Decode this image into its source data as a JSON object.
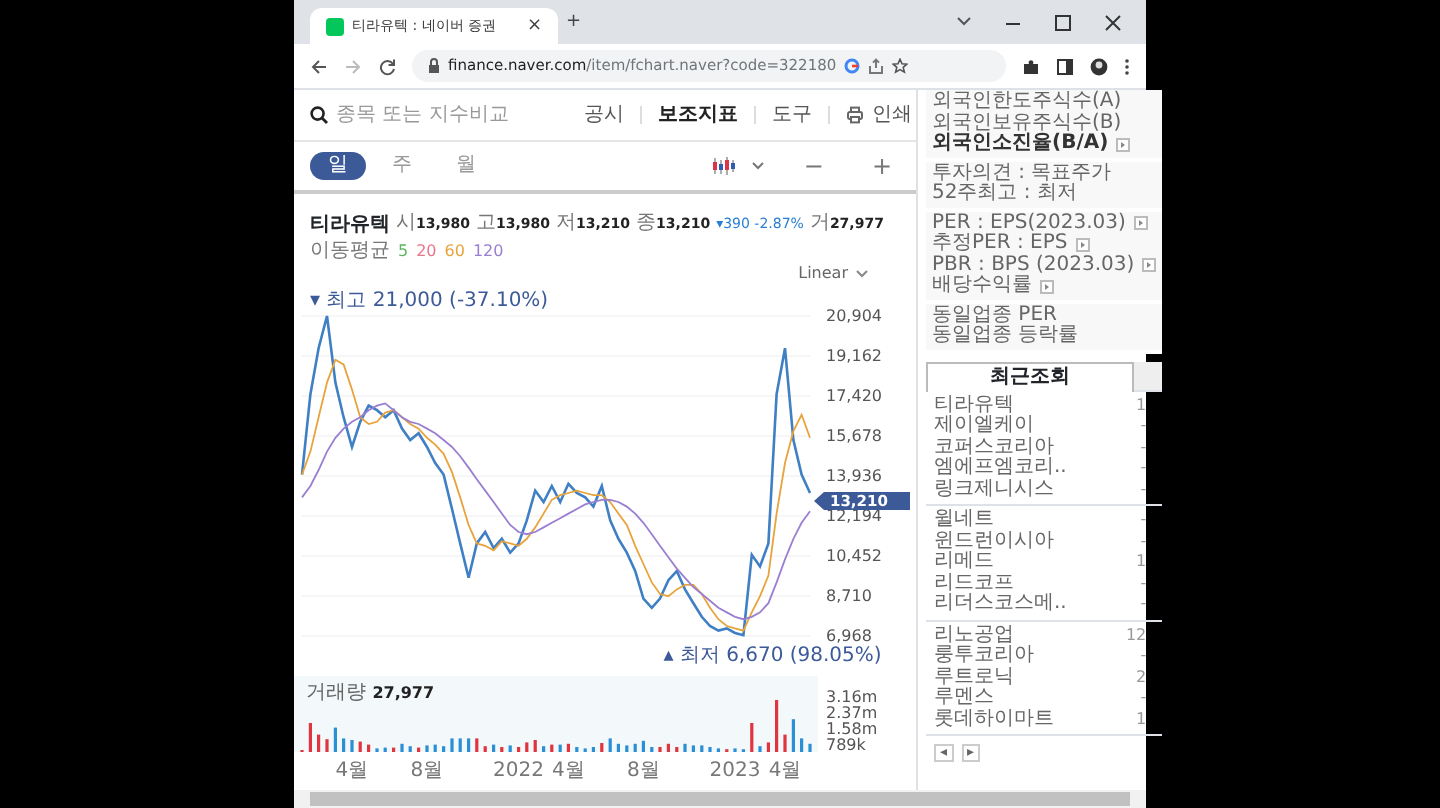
{
  "browser": {
    "tab": {
      "title": "티라유텍 : 네이버 증권",
      "selected": true
    },
    "tab_close": "×",
    "new_tab": "+",
    "url_host": "finance.naver.com",
    "url_path": "/item/fchart.naver?code=322180"
  },
  "search": {
    "placeholder": "종목 또는 지수비교"
  },
  "tools": [
    {
      "label": "공시",
      "kind": "link"
    },
    {
      "label": "보조지표",
      "kind": "bold"
    },
    {
      "label": "도구",
      "kind": "link"
    },
    {
      "label": "인쇄",
      "kind": "print"
    }
  ],
  "periods": [
    {
      "label": "일",
      "selected": true
    },
    {
      "label": "주",
      "selected": false
    },
    {
      "label": "월",
      "selected": false
    }
  ],
  "zoom": [
    "−",
    "+"
  ],
  "quote": {
    "items": [
      {
        "label": "시",
        "value": "13,980"
      },
      {
        "label": "고",
        "value": "13,980"
      },
      {
        "label": "저",
        "value": "13,210"
      },
      {
        "label": "종",
        "value": "13,210"
      }
    ],
    "change": "▾390 -2.87%",
    "volume_label": "거",
    "volume": "27,977"
  },
  "moving_average": {
    "label": "이동평균",
    "periods": [
      {
        "label": "5",
        "color": "#5cb85c"
      },
      {
        "label": "20",
        "color": "#e8768a"
      }
    ]
  },
  "scale": "Linear",
  "chart": {
    "high_label": "▾ 최고 21,000 (-37.10%)",
    "low_label": "▴ 최저 6,670 (98.05%)",
    "current_price": "13,210",
    "chart_data": {
      "type": "line",
      "grid": true,
      "ylim": [
        6968,
        20904
      ],
      "categories": [
        null,
        null,
        null,
        null,
        null,
        null,
        "4월",
        null,
        null,
        null,
        null,
        null,
        null,
        null,
        null,
        "8월",
        null,
        null,
        null,
        null,
        null,
        null,
        null,
        null,
        null,
        null,
        "2022",
        null,
        null,
        null,
        null,
        null,
        "4월",
        null,
        null,
        null,
        null,
        null,
        null,
        null,
        null,
        "8월",
        null,
        null,
        null,
        null,
        null,
        null,
        null,
        null,
        null,
        null,
        "2023",
        null,
        null,
        null,
        null,
        null,
        "4월",
        null,
        null,
        null
      ],
      "series": [
        {
          "name": "티라유텍",
          "color": "#3f7fc4",
          "values": [
            14000,
            17500,
            19500,
            20900,
            18000,
            16500,
            15200,
            16300,
            17000,
            16800,
            16500,
            16800,
            16000,
            15500,
            15800,
            15200,
            14500,
            14000,
            12500,
            11000,
            9500,
            11000,
            11500,
            10800,
            11200,
            10600,
            11000,
            12000,
            13300,
            12800,
            13500,
            12800,
            13600,
            13200,
            13000,
            12600,
            13500,
            12000,
            11200,
            10600,
            9800,
            8600,
            8200,
            8600,
            9400,
            9800,
            9000,
            8400,
            7800,
            7400,
            7200,
            7300,
            7100,
            7000,
            10500,
            10000,
            11000,
            17500,
            19500,
            15500,
            14000,
            13200
          ]
        },
        {
          "name": "60",
          "color": "#e8a33c",
          "values": [
            14000,
            15000,
            16500,
            18000,
            19000,
            18800,
            17700,
            16500,
            16200,
            16300,
            16700,
            16800,
            16500,
            16200,
            16000,
            15600,
            15300,
            14900,
            14100,
            13000,
            11800,
            11000,
            10900,
            10700,
            11100,
            11000,
            10900,
            11200,
            11700,
            12300,
            12900,
            13100,
            13200,
            13300,
            13200,
            13100,
            13100,
            12800,
            12300,
            11800,
            10900,
            10100,
            9300,
            8800,
            8700,
            9000,
            9200,
            9200,
            8800,
            8200,
            7700,
            7400,
            7300,
            7200,
            8000,
            8700,
            9600,
            12300,
            14500,
            15900,
            16600,
            15600
          ]
        },
        {
          "name": "120",
          "color": "#9a7fd1",
          "values": [
            13000,
            13500,
            14200,
            15000,
            15600,
            16000,
            16300,
            16500,
            16800,
            17000,
            17100,
            16800,
            16500,
            16300,
            16200,
            16000,
            15800,
            15500,
            15200,
            14800,
            14300,
            13800,
            13300,
            12800,
            12300,
            11800,
            11500,
            11400,
            11500,
            11700,
            11900,
            12100,
            12300,
            12500,
            12700,
            12800,
            12900,
            12900,
            12800,
            12600,
            12300,
            11900,
            11400,
            10900,
            10400,
            9900,
            9500,
            9100,
            8800,
            8500,
            8200,
            8000,
            7800,
            7700,
            7800,
            8000,
            8400,
            9300,
            10300,
            11200,
            11900,
            12400
          ]
        }
      ],
      "yticks": [
        {
          "value": 20904,
          "label": "20,904"
        },
        {
          "value": 19162,
          "label": "19,162"
        },
        {
          "value": 17420,
          "label": "17,420"
        },
        {
          "value": 15678,
          "label": "15,678"
        },
        {
          "value": 13936,
          "label": "13,936"
        },
        {
          "value": 12194,
          "label": "12,194"
        },
        {
          "value": 10452,
          "label": "10,452"
        },
        {
          "value": 8710,
          "label": "8,710"
        },
        {
          "value": 6968,
          "label": "6,968"
        }
      ]
    },
    "volume": {
      "label": "거래량",
      "value": "27,977",
      "ticks": [
        "3.16m",
        "2.37m",
        "1.58m",
        "789k"
      ]
    }
  },
  "sidebar": {
    "info_groups": [
      [
        {
          "text": "외국인한도주식수(A)",
          "bold": false,
          "toggle": false
        },
        {
          "text": "외국인보유주식수(B)",
          "bold": false,
          "toggle": false
        },
        {
          "text": "외국인소진율(B/A)",
          "bold": true,
          "toggle": true
        }
      ],
      [
        {
          "text": "투자의견 : 목표주가",
          "bold": false,
          "toggle": false
        },
        {
          "text": "52주최고 : 최저",
          "bold": false,
          "toggle": false
        }
      ],
      [
        {
          "text": "PER : EPS(2023.03)",
          "bold": false,
          "toggle": true
        },
        {
          "text": "추정PER : EPS",
          "bold": false,
          "toggle": true
        },
        {
          "text": "PBR : BPS (2023.03)",
          "bold": false,
          "toggle": true
        },
        {
          "text": "배당수익률",
          "bold": false,
          "toggle": true
        }
      ],
      [
        {
          "text": "동일업종 PER",
          "bold": false,
          "toggle": false
        },
        {
          "text": "동일업종 등락률",
          "bold": false,
          "toggle": false
        }
      ]
    ],
    "recent_tab": "최근조회",
    "recent_groups": [
      [
        {
          "name": "티라유텍",
          "count": "1"
        },
        {
          "name": "제이엘케이",
          "count": "-"
        },
        {
          "name": "코퍼스코리아",
          "count": "-"
        },
        {
          "name": "엠에프엠코리..",
          "count": "-"
        },
        {
          "name": "링크제니시스",
          "count": "-"
        }
      ],
      [
        {
          "name": "윌네트",
          "count": "-"
        },
        {
          "name": "윈드런이시아",
          "count": "-"
        },
        {
          "name": "리메드",
          "count": "1"
        },
        {
          "name": "리드코프",
          "count": "-"
        },
        {
          "name": "리더스코스메..",
          "count": "-"
        }
      ],
      [
        {
          "name": "리노공업",
          "count": "12"
        },
        {
          "name": "룽투코리아",
          "count": "-"
        },
        {
          "name": "루트로닉",
          "count": "2"
        },
        {
          "name": "루멘스",
          "count": "-"
        },
        {
          "name": "롯데하이마트",
          "count": "1"
        }
      ]
    ],
    "pager": [
      "◂",
      "▸"
    ]
  }
}
